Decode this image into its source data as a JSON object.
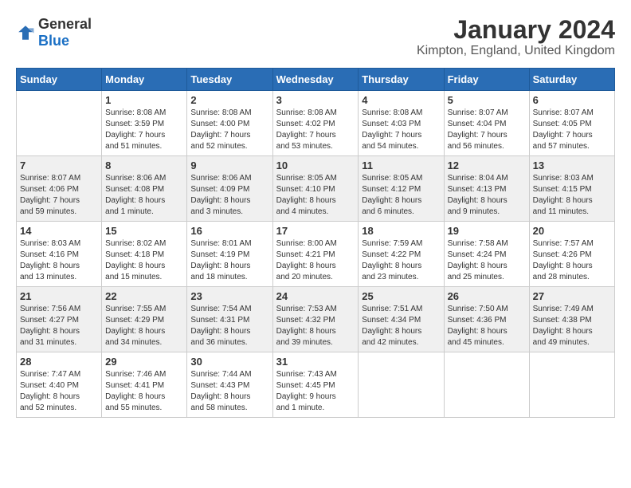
{
  "header": {
    "logo_general": "General",
    "logo_blue": "Blue",
    "month_title": "January 2024",
    "location": "Kimpton, England, United Kingdom"
  },
  "days_of_week": [
    "Sunday",
    "Monday",
    "Tuesday",
    "Wednesday",
    "Thursday",
    "Friday",
    "Saturday"
  ],
  "weeks": [
    [
      {
        "day": "",
        "info": ""
      },
      {
        "day": "1",
        "info": "Sunrise: 8:08 AM\nSunset: 3:59 PM\nDaylight: 7 hours\nand 51 minutes."
      },
      {
        "day": "2",
        "info": "Sunrise: 8:08 AM\nSunset: 4:00 PM\nDaylight: 7 hours\nand 52 minutes."
      },
      {
        "day": "3",
        "info": "Sunrise: 8:08 AM\nSunset: 4:02 PM\nDaylight: 7 hours\nand 53 minutes."
      },
      {
        "day": "4",
        "info": "Sunrise: 8:08 AM\nSunset: 4:03 PM\nDaylight: 7 hours\nand 54 minutes."
      },
      {
        "day": "5",
        "info": "Sunrise: 8:07 AM\nSunset: 4:04 PM\nDaylight: 7 hours\nand 56 minutes."
      },
      {
        "day": "6",
        "info": "Sunrise: 8:07 AM\nSunset: 4:05 PM\nDaylight: 7 hours\nand 57 minutes."
      }
    ],
    [
      {
        "day": "7",
        "info": "Sunrise: 8:07 AM\nSunset: 4:06 PM\nDaylight: 7 hours\nand 59 minutes."
      },
      {
        "day": "8",
        "info": "Sunrise: 8:06 AM\nSunset: 4:08 PM\nDaylight: 8 hours\nand 1 minute."
      },
      {
        "day": "9",
        "info": "Sunrise: 8:06 AM\nSunset: 4:09 PM\nDaylight: 8 hours\nand 3 minutes."
      },
      {
        "day": "10",
        "info": "Sunrise: 8:05 AM\nSunset: 4:10 PM\nDaylight: 8 hours\nand 4 minutes."
      },
      {
        "day": "11",
        "info": "Sunrise: 8:05 AM\nSunset: 4:12 PM\nDaylight: 8 hours\nand 6 minutes."
      },
      {
        "day": "12",
        "info": "Sunrise: 8:04 AM\nSunset: 4:13 PM\nDaylight: 8 hours\nand 9 minutes."
      },
      {
        "day": "13",
        "info": "Sunrise: 8:03 AM\nSunset: 4:15 PM\nDaylight: 8 hours\nand 11 minutes."
      }
    ],
    [
      {
        "day": "14",
        "info": "Sunrise: 8:03 AM\nSunset: 4:16 PM\nDaylight: 8 hours\nand 13 minutes."
      },
      {
        "day": "15",
        "info": "Sunrise: 8:02 AM\nSunset: 4:18 PM\nDaylight: 8 hours\nand 15 minutes."
      },
      {
        "day": "16",
        "info": "Sunrise: 8:01 AM\nSunset: 4:19 PM\nDaylight: 8 hours\nand 18 minutes."
      },
      {
        "day": "17",
        "info": "Sunrise: 8:00 AM\nSunset: 4:21 PM\nDaylight: 8 hours\nand 20 minutes."
      },
      {
        "day": "18",
        "info": "Sunrise: 7:59 AM\nSunset: 4:22 PM\nDaylight: 8 hours\nand 23 minutes."
      },
      {
        "day": "19",
        "info": "Sunrise: 7:58 AM\nSunset: 4:24 PM\nDaylight: 8 hours\nand 25 minutes."
      },
      {
        "day": "20",
        "info": "Sunrise: 7:57 AM\nSunset: 4:26 PM\nDaylight: 8 hours\nand 28 minutes."
      }
    ],
    [
      {
        "day": "21",
        "info": "Sunrise: 7:56 AM\nSunset: 4:27 PM\nDaylight: 8 hours\nand 31 minutes."
      },
      {
        "day": "22",
        "info": "Sunrise: 7:55 AM\nSunset: 4:29 PM\nDaylight: 8 hours\nand 34 minutes."
      },
      {
        "day": "23",
        "info": "Sunrise: 7:54 AM\nSunset: 4:31 PM\nDaylight: 8 hours\nand 36 minutes."
      },
      {
        "day": "24",
        "info": "Sunrise: 7:53 AM\nSunset: 4:32 PM\nDaylight: 8 hours\nand 39 minutes."
      },
      {
        "day": "25",
        "info": "Sunrise: 7:51 AM\nSunset: 4:34 PM\nDaylight: 8 hours\nand 42 minutes."
      },
      {
        "day": "26",
        "info": "Sunrise: 7:50 AM\nSunset: 4:36 PM\nDaylight: 8 hours\nand 45 minutes."
      },
      {
        "day": "27",
        "info": "Sunrise: 7:49 AM\nSunset: 4:38 PM\nDaylight: 8 hours\nand 49 minutes."
      }
    ],
    [
      {
        "day": "28",
        "info": "Sunrise: 7:47 AM\nSunset: 4:40 PM\nDaylight: 8 hours\nand 52 minutes."
      },
      {
        "day": "29",
        "info": "Sunrise: 7:46 AM\nSunset: 4:41 PM\nDaylight: 8 hours\nand 55 minutes."
      },
      {
        "day": "30",
        "info": "Sunrise: 7:44 AM\nSunset: 4:43 PM\nDaylight: 8 hours\nand 58 minutes."
      },
      {
        "day": "31",
        "info": "Sunrise: 7:43 AM\nSunset: 4:45 PM\nDaylight: 9 hours\nand 1 minute."
      },
      {
        "day": "",
        "info": ""
      },
      {
        "day": "",
        "info": ""
      },
      {
        "day": "",
        "info": ""
      }
    ]
  ]
}
